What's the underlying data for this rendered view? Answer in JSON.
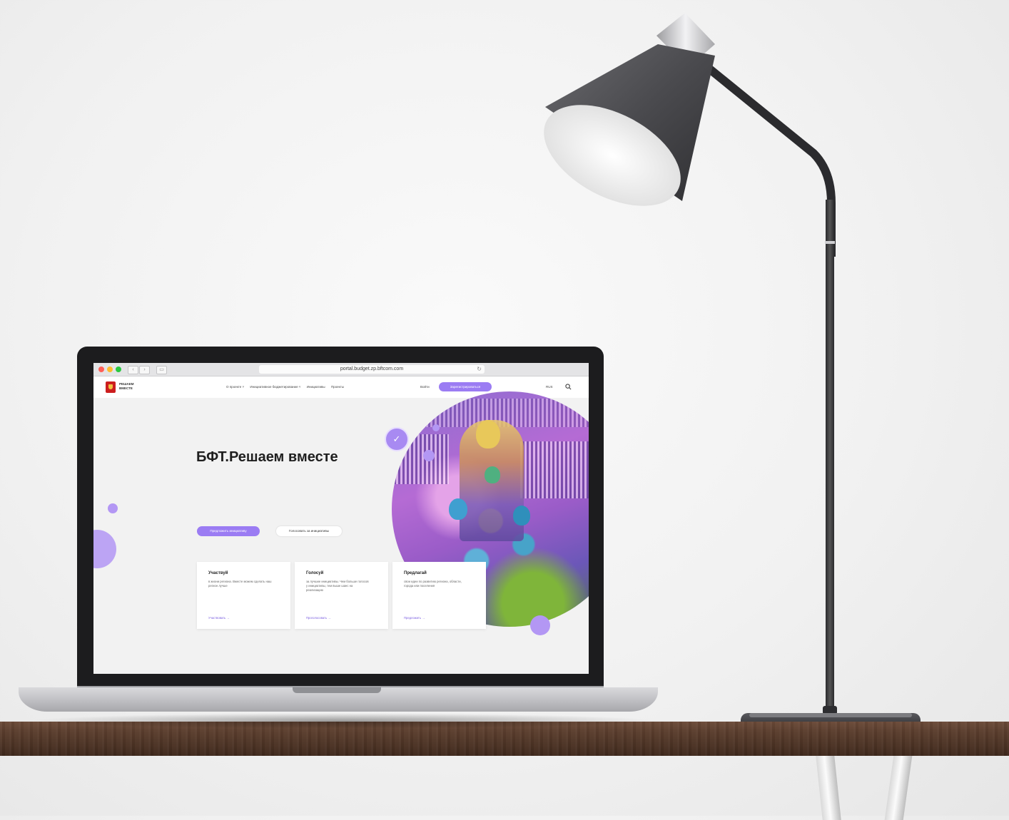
{
  "browser": {
    "url": "portal.budget.zp.bftcom.com"
  },
  "site": {
    "logo_text": "РЕШАЕМ ВМЕСТЕ",
    "nav": [
      "О проекте ˅",
      "Инициативное бюджетирование ˅",
      "Инициативы",
      "Проекты"
    ],
    "login_label": "Войти",
    "register_label": "Зарегистрироваться",
    "lang_label": "RUS",
    "hero_title": "БФТ.Решаем вместе",
    "primary_button": "Предложить инициативу",
    "secondary_button": "Голосовать за инициативы",
    "cards": [
      {
        "title": "Участвуй",
        "text": "в жизни региона. Вместе можем сделать наш регион лучше",
        "link": "Участвовать →"
      },
      {
        "title": "Голосуй",
        "text": "за лучшие инициативы. Чем больше голосов у инициативы, тем выше шанс на реализацию",
        "link": "Проголосовать →"
      },
      {
        "title": "Предлагай",
        "text": "свои идеи по развитию региона, области, города или поселения",
        "link": "Предложить →"
      }
    ]
  },
  "colors": {
    "accent": "#9b7cf3",
    "desk": "#5a3d2d",
    "laptop_bezel": "#1c1c1e",
    "lamp": "#3c3c40"
  },
  "icons": {
    "search": "search-icon",
    "check": "check-icon",
    "logo": "coat-of-arms-icon"
  }
}
